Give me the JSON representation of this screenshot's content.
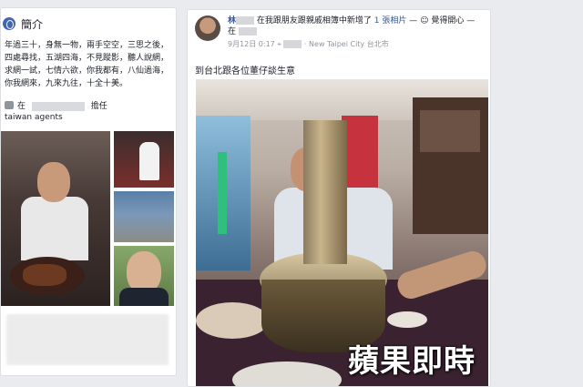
{
  "intro": {
    "title": "簡介",
    "bio": "年過三十，身無一物，兩手空空，三思之後，四處尋找，五湖四海，不見蹤影，聽人說網，求網一試，七情六欲，你我都有，八仙過海，你我網來，九來九往，十全十美。",
    "work_prefix": "在",
    "work_suffix": "擔任",
    "work_role": "taiwan agents"
  },
  "post": {
    "author_name": "林",
    "header_text_1": "在我跟朋友跟親戚相簿中新增了",
    "header_count": "1 張相片",
    "header_text_2": "— ",
    "header_feeling": "覺得開心",
    "header_at": "— 在",
    "meta_date": "9月12日 0:17",
    "meta_place": "New Taipei City 台北市",
    "caption": "到台北跟各位董仔談生意"
  },
  "watermark": "蘋果即時"
}
